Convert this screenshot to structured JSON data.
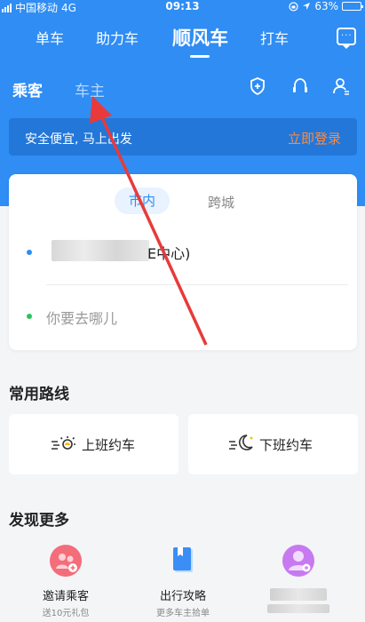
{
  "status_bar": {
    "carrier": "中国移动",
    "network": "4G",
    "time": "09:13",
    "battery": "63%",
    "battery_level": 0.63
  },
  "main_tabs": [
    {
      "label": "单车"
    },
    {
      "label": "助力车"
    },
    {
      "label": "顺风车",
      "active": true
    },
    {
      "label": "打车"
    }
  ],
  "sub_tabs": {
    "passenger": "乘客",
    "driver": "车主"
  },
  "header_icons": [
    "shield-plus-icon",
    "headset-icon",
    "user-icon",
    "message-icon"
  ],
  "banner": {
    "text": "安全便宜, 马上出发",
    "login": "立即登录"
  },
  "trip_card": {
    "segments": {
      "local": "市内",
      "intercity": "跨城"
    },
    "from_text": "E中心)",
    "to_placeholder": "你要去哪儿"
  },
  "common_routes": {
    "title": "常用路线",
    "work": "上班约车",
    "home": "下班约车"
  },
  "discover": {
    "title": "发现更多",
    "items": [
      {
        "label": "邀请乘客",
        "sub": "送10元礼包"
      },
      {
        "label": "出行攻略",
        "sub": "更多车主拾单"
      }
    ]
  },
  "colors": {
    "primary": "#2f8df4",
    "banner_bg": "#2377d8",
    "login_accent": "#ff8a3c",
    "arrow": "#e83a3a"
  }
}
